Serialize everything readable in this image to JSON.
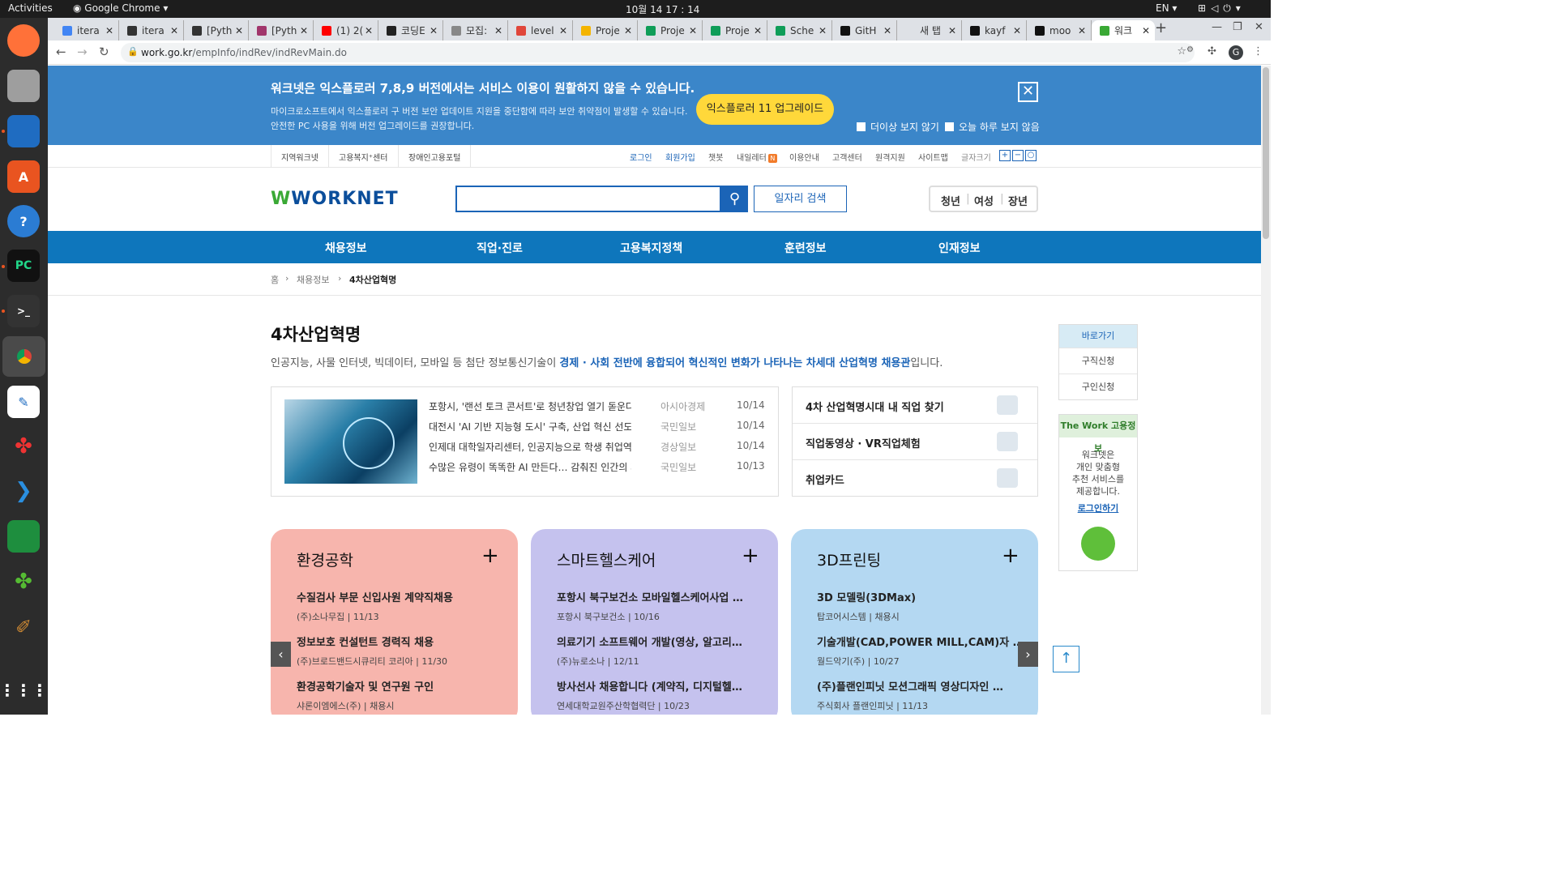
{
  "os": {
    "activities": "Activities",
    "app_name": "Google Chrome",
    "clock": "10월 14  17 : 14",
    "lang": "EN"
  },
  "tabs": [
    {
      "label": "itera",
      "color": "#4285f4"
    },
    {
      "label": "itera",
      "color": "#333333"
    },
    {
      "label": "[Pyth",
      "color": "#333333"
    },
    {
      "label": "[Pyth",
      "color": "#a1356b"
    },
    {
      "label": "(1) 2(",
      "color": "#ff0000"
    },
    {
      "label": "코딩E",
      "color": "#222222"
    },
    {
      "label": "모집:",
      "color": "#888888"
    },
    {
      "label": "level",
      "color": "#e0463a"
    },
    {
      "label": "Proje",
      "color": "#f4b400"
    },
    {
      "label": "Proje",
      "color": "#0f9d58"
    },
    {
      "label": "Proje",
      "color": "#0f9d58"
    },
    {
      "label": "Sche",
      "color": "#0f9d58"
    },
    {
      "label": "GitH",
      "color": "#111111"
    },
    {
      "label": "새 탭",
      "color": "#dee1e6"
    },
    {
      "label": "kayf",
      "color": "#111111"
    },
    {
      "label": "moo",
      "color": "#111111"
    },
    {
      "label": "워크",
      "color": "#3aa935"
    }
  ],
  "url": {
    "host": "work.go.kr",
    "path": "/empInfo/indRev/indRevMain.do"
  },
  "profile_initial": "G",
  "banner": {
    "title": "워크넷은 익스플로러 7,8,9 버전에서는 서비스 이용이 원활하지 않을 수 있습니다.",
    "line1": "마이크로소프트에서 익스플로러 구 버전 보안 업데이트 지원을 중단함에 따라 보안 취약점이 발생할 수 있습니다.",
    "line2": "안전한 PC 사용을 위해 버전 업그레이드를 권장합니다.",
    "upgrade": "익스플로러 11 업그레이드",
    "no_more": "더이상 보지 않기",
    "today": "오늘 하루 보지 않음"
  },
  "util_left": [
    "지역워크넷",
    "고용복지⁺센터",
    "장애인고용포털"
  ],
  "util_right": {
    "login": "로그인",
    "join": "회원가입",
    "chatbot": "챗봇",
    "letter": "내일레터",
    "badge": "N",
    "guide": "이용안내",
    "cs": "고객센터",
    "remote": "원격지원",
    "sitemap": "사이트맵",
    "fontsize": "글자크기"
  },
  "logo": "WORKNET",
  "job_search": "일자리 검색",
  "target": [
    "청년",
    "여성",
    "장년"
  ],
  "gnb": [
    "채용정보",
    "직업·진로",
    "고용복지정책",
    "훈련정보",
    "인재정보"
  ],
  "breadcrumb": {
    "home": "홈",
    "parent": "채용정보",
    "current": "4차산업혁명"
  },
  "page_title": "4차산업혁명",
  "lead": {
    "pre": "인공지능, 사물 인터넷, 빅데이터, 모바일 등 첨단 정보통신기술이 ",
    "strong": "경제 · 사회 전반에 융합되어 혁신적인 변화가 나타나는 차세대 산업혁명 채용관",
    "post": "입니다."
  },
  "news": [
    {
      "title": "포항시, '랜선 토크 콘서트'로 청년창업 열기 돋운다",
      "source": "아시아경제",
      "date": "10/14"
    },
    {
      "title": "대전시 'AI 기반 지능형 도시' 구축, 산업 혁신 선도 야망",
      "source": "국민일보",
      "date": "10/14"
    },
    {
      "title": "인제대 대학일자리센터, 인공지능으로 학생 취업역량 강화",
      "source": "경상일보",
      "date": "10/14"
    },
    {
      "title": "수많은 유령이 똑똑한 AI 만든다… 감춰진 인간의 피땀 [...",
      "source": "국민일보",
      "date": "10/13"
    }
  ],
  "links": [
    "4차 산업혁명시대 내 직업 찾기",
    "직업동영상 · VR직업체험",
    "취업카드"
  ],
  "quick": {
    "title": "바로가기",
    "items": [
      "구직신청",
      "구인신청"
    ]
  },
  "thework": {
    "title": "The Work 고용정보",
    "lines": [
      "워크넷은",
      "개인 맞춤형",
      "추천 서비스를",
      "제공합니다."
    ],
    "login": "로그인하기"
  },
  "cards": [
    {
      "title": "환경공학",
      "bg": "#f7b5ad",
      "jobs": [
        {
          "t": "수질검사 부문 신입사원 계약직채용",
          "s": "(주)소나무집   |   11/13"
        },
        {
          "t": "정보보호 컨설턴트 경력직 채용",
          "s": "(주)브로드밴드시큐리티 코리아   |   11/30"
        },
        {
          "t": "환경공학기술자 및 연구원 구인",
          "s": "샤론이엠에스(주)   |   채용시"
        }
      ]
    },
    {
      "title": "스마트헬스케어",
      "bg": "#c5c2ee",
      "jobs": [
        {
          "t": "포항시 북구보건소 모바일헬스케어사업 …",
          "s": "포항시 북구보건소   |   10/16"
        },
        {
          "t": "의료기기 소프트웨어 개발(영상, 알고리…",
          "s": "(주)뉴로소나   |   12/11"
        },
        {
          "t": "방사선사 채용합니다 (계약직, 디지털헬…",
          "s": "연세대학교원주산학협력단   |   10/23"
        }
      ]
    },
    {
      "title": "3D프린팅",
      "bg": "#b4d8f2",
      "jobs": [
        {
          "t": "3D 모델링(3DMax)",
          "s": "탑코어시스템   |   채용시"
        },
        {
          "t": "기술개발(CAD,POWER MILL,CAM)자 …",
          "s": "월드악기(주)   |   10/27"
        },
        {
          "t": "(주)플랜인피닛 모션그래픽 영상디자인 …",
          "s": "주식회사 플랜인피닛   |   11/13"
        }
      ]
    }
  ],
  "icons": {
    "card_plus": "+",
    "prev": "‹",
    "next": "›",
    "to_top": "↑",
    "search": "⚲",
    "close": "✕"
  }
}
